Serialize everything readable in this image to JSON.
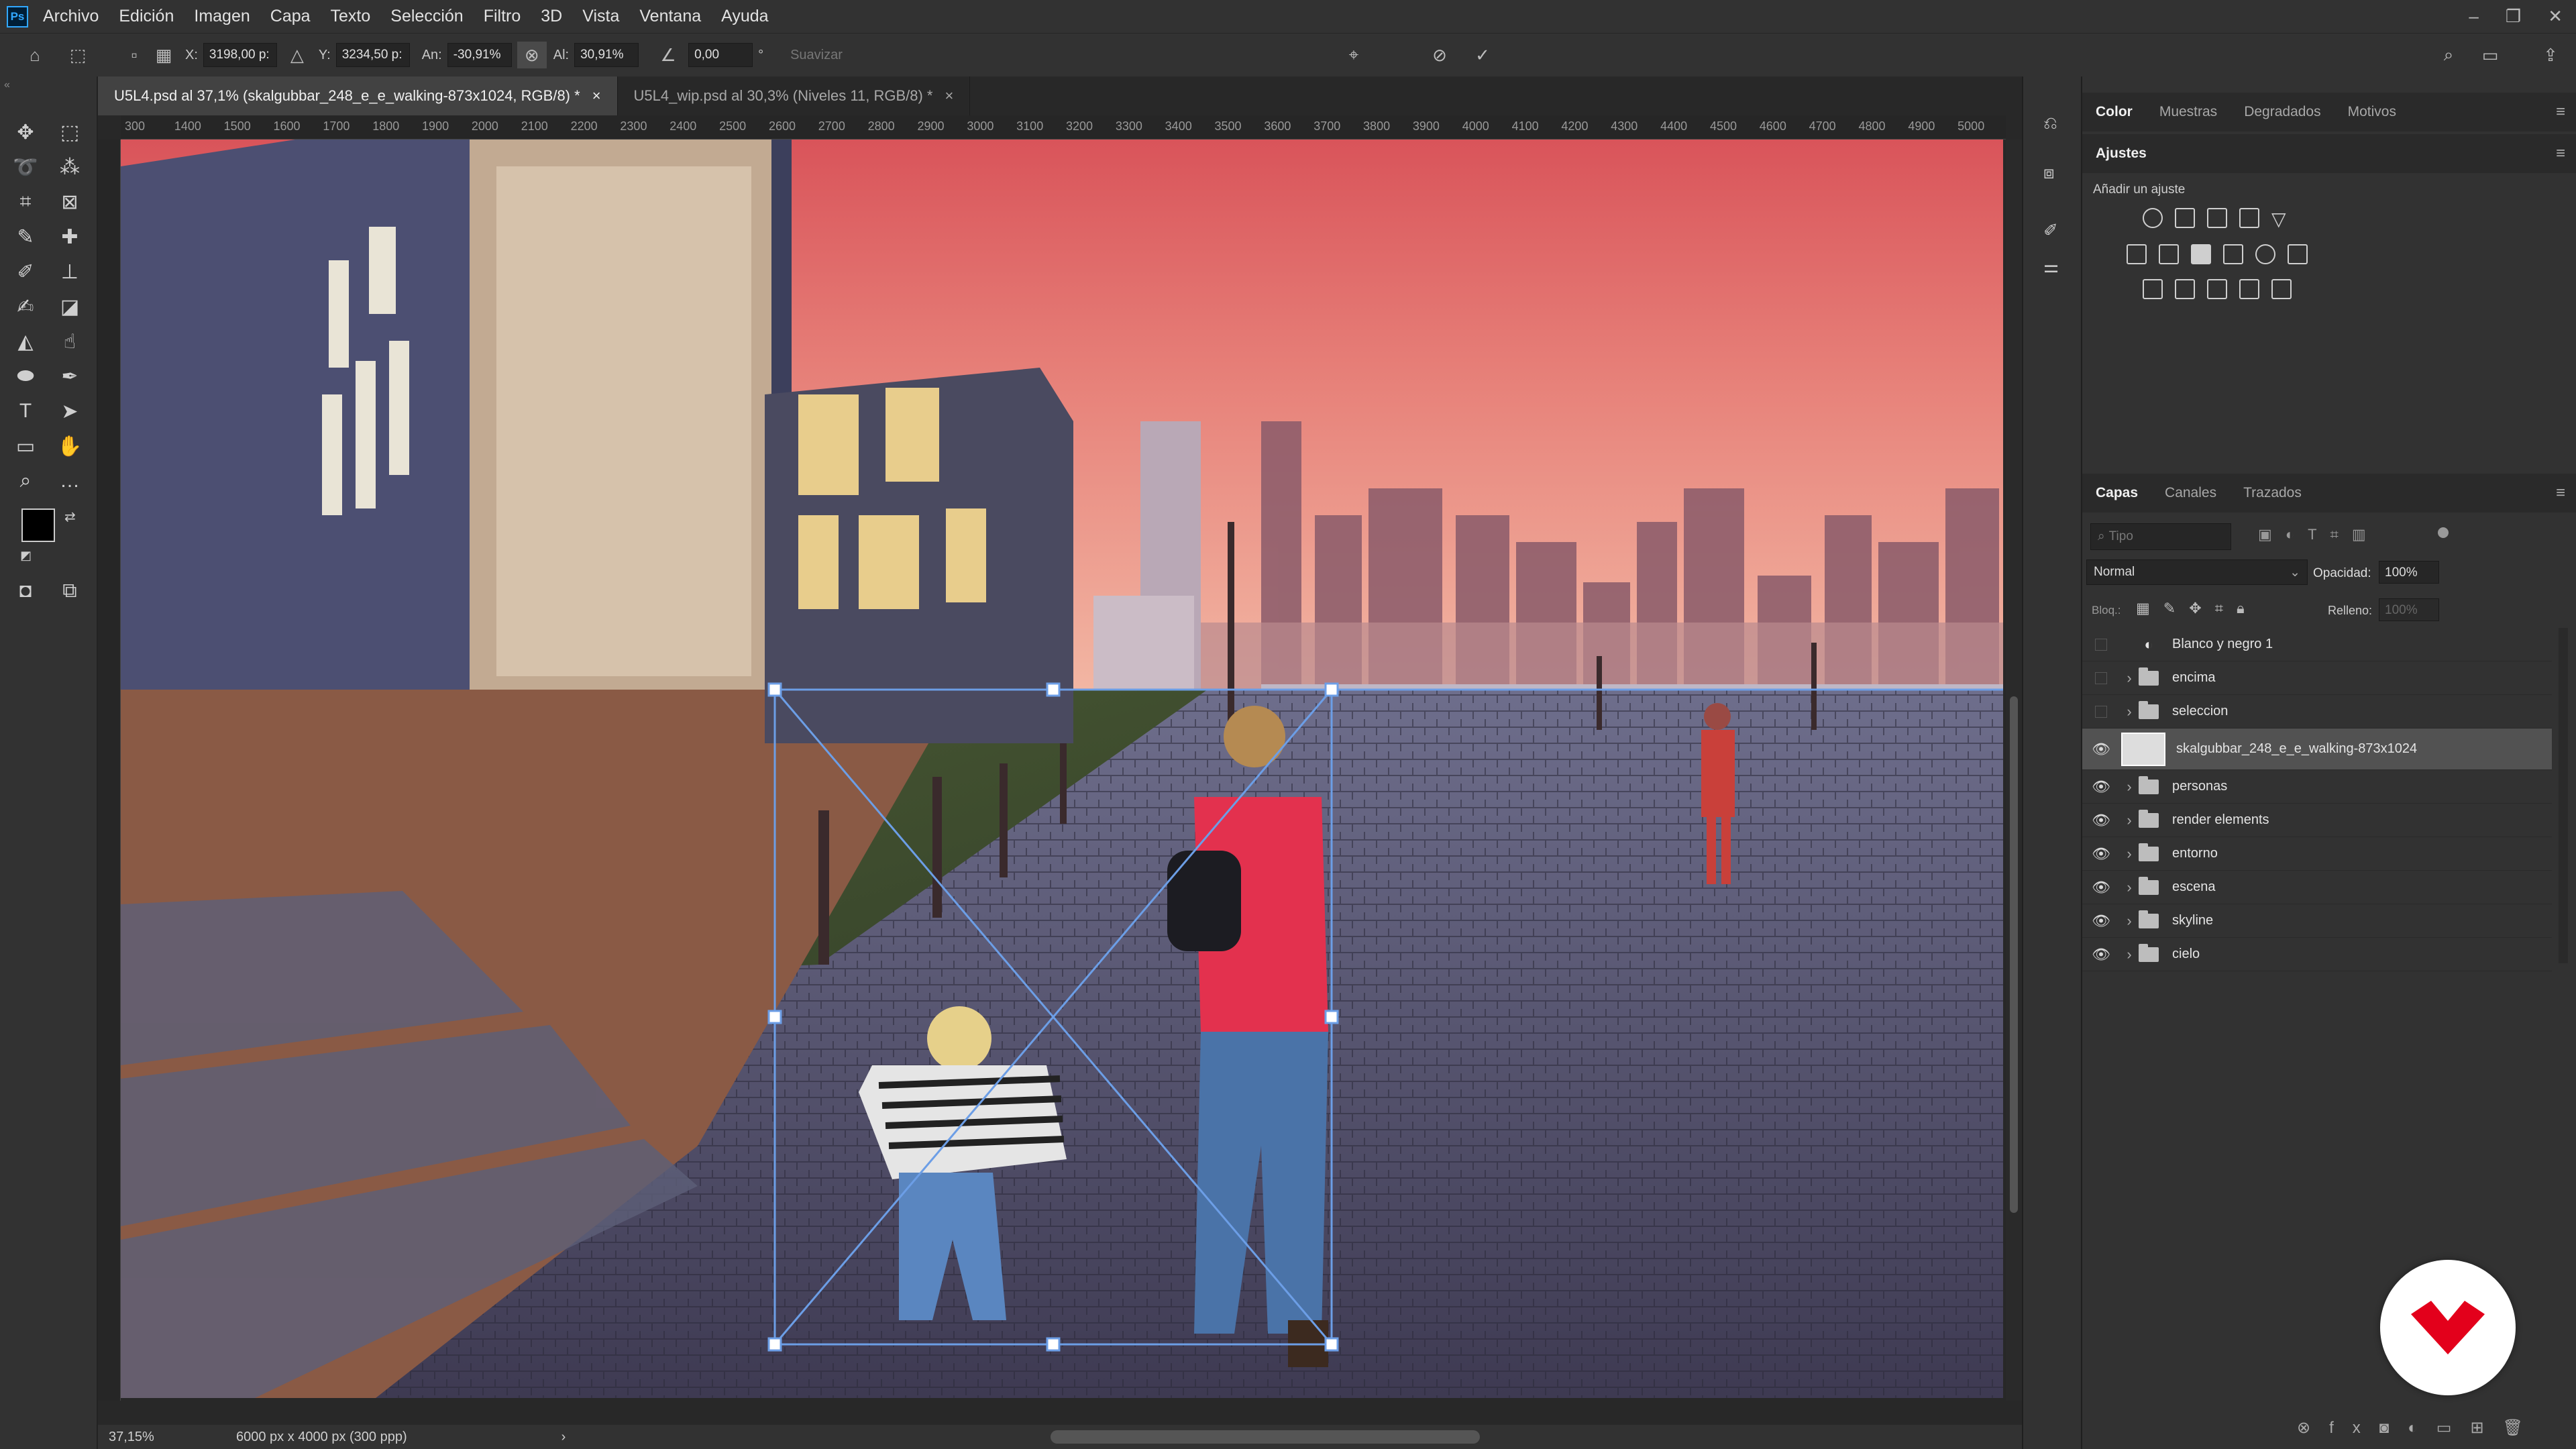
{
  "menubar": {
    "logo": "Ps",
    "items": [
      "Archivo",
      "Edición",
      "Imagen",
      "Capa",
      "Texto",
      "Selección",
      "Filtro",
      "3D",
      "Vista",
      "Ventana",
      "Ayuda"
    ]
  },
  "options": {
    "x_label": "X:",
    "x_value": "3198,00 p:",
    "y_label": "Y:",
    "y_value": "3234,50 p:",
    "w_label": "An:",
    "w_value": "-30,91%",
    "h_label": "Al:",
    "h_value": "30,91%",
    "angle_value": "0,00",
    "angle_unit": "°",
    "smooth_label": "Suavizar"
  },
  "tabs": [
    {
      "label": "U5L4.psd al 37,1% (skalgubbar_248_e_e_walking-873x1024, RGB/8) *",
      "close": "×"
    },
    {
      "label": "U5L4_wip.psd al 30,3% (Niveles 11, RGB/8) *",
      "close": "×"
    }
  ],
  "ruler": {
    "ticks": [
      "300",
      "1400",
      "1500",
      "1600",
      "1700",
      "1800",
      "1900",
      "2000",
      "2100",
      "2200",
      "2300",
      "2400",
      "2500",
      "2600",
      "2700",
      "2800",
      "2900",
      "3000",
      "3100",
      "3200",
      "3300",
      "3400",
      "3500",
      "3600",
      "3700",
      "3800",
      "3900",
      "4000",
      "4100",
      "4200",
      "4300",
      "4400",
      "4500",
      "4600",
      "4700",
      "4800",
      "4900",
      "5000"
    ]
  },
  "status": {
    "zoom": "37,15%",
    "doc_size": "6000 px x 4000 px (300 ppp)",
    "arrow": "›"
  },
  "color_panel": {
    "tabs": [
      "Color",
      "Muestras",
      "Degradados",
      "Motivos"
    ]
  },
  "adjustments": {
    "tab": "Ajustes",
    "subtitle": "Añadir un ajuste"
  },
  "layers_panel": {
    "tabs": [
      "Capas",
      "Canales",
      "Trazados"
    ],
    "filter_placeholder": "Tipo",
    "blend_mode": "Normal",
    "opacity_label": "Opacidad:",
    "opacity_value": "100%",
    "lock_label": "Bloq.:",
    "fill_label": "Relleno:",
    "fill_value": "100%",
    "layers": [
      {
        "name": "Blanco y negro 1",
        "visible": false,
        "kind": "adjustment"
      },
      {
        "name": "encima",
        "visible": false,
        "kind": "group"
      },
      {
        "name": "seleccion",
        "visible": false,
        "kind": "group"
      },
      {
        "name": "skalgubbar_248_e_e_walking-873x1024",
        "visible": true,
        "kind": "smart",
        "selected": true
      },
      {
        "name": "personas",
        "visible": true,
        "kind": "group"
      },
      {
        "name": "render elements",
        "visible": true,
        "kind": "group"
      },
      {
        "name": "entorno",
        "visible": true,
        "kind": "group"
      },
      {
        "name": "escena",
        "visible": true,
        "kind": "group"
      },
      {
        "name": "skyline",
        "visible": true,
        "kind": "group"
      },
      {
        "name": "cielo",
        "visible": true,
        "kind": "group"
      }
    ]
  },
  "colors": {
    "accent": "#31a8ff",
    "badge_red": "#e3001b"
  }
}
